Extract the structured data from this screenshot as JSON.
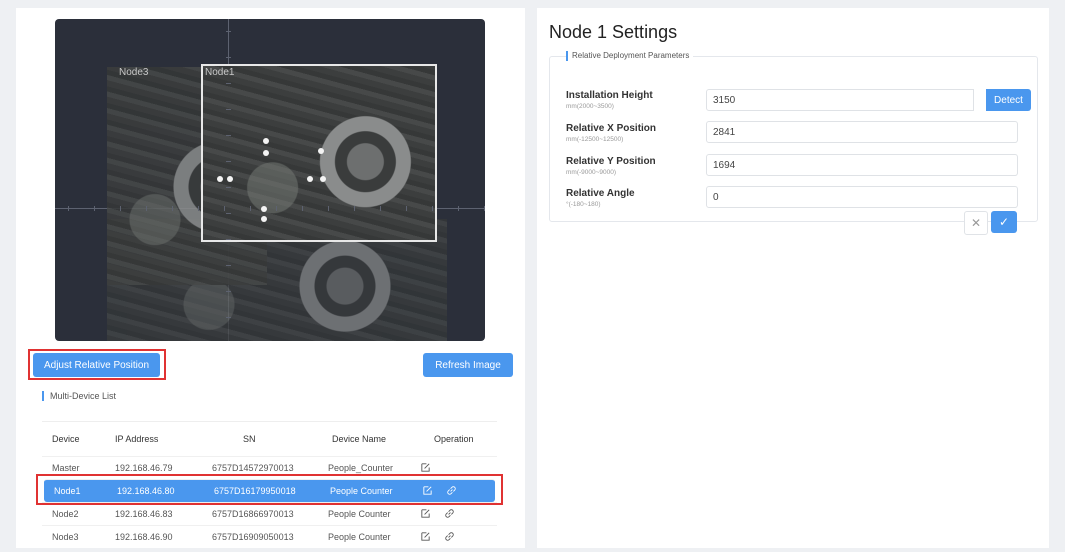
{
  "camera": {
    "node3_label": "Node3",
    "node1_label": "Node1"
  },
  "actions": {
    "adjust_label": "Adjust Relative Position",
    "refresh_label": "Refresh Image"
  },
  "device_list": {
    "title": "Multi-Device List",
    "columns": [
      "Device",
      "IP Address",
      "SN",
      "Device Name",
      "Operation"
    ],
    "rows": [
      {
        "device": "Master",
        "ip": "192.168.46.79",
        "sn": "6757D14572970013",
        "name": "People_Counter",
        "selected": false
      },
      {
        "device": "Node1",
        "ip": "192.168.46.80",
        "sn": "6757D16179950018",
        "name": "People Counter",
        "selected": true
      },
      {
        "device": "Node2",
        "ip": "192.168.46.83",
        "sn": "6757D16866970013",
        "name": "People Counter",
        "selected": false
      },
      {
        "device": "Node3",
        "ip": "192.168.46.90",
        "sn": "6757D16909050013",
        "name": "People Counter",
        "selected": false
      }
    ]
  },
  "settings": {
    "title": "Node 1 Settings",
    "section": "Relative Deployment Parameters",
    "fields": [
      {
        "label": "Installation Height",
        "hint": "mm(2000~3500)",
        "value": "3150"
      },
      {
        "label": "Relative X Position",
        "hint": "mm(-12500~12500)",
        "value": "2841"
      },
      {
        "label": "Relative Y Position",
        "hint": "mm(-9000~9000)",
        "value": "1694"
      },
      {
        "label": "Relative Angle",
        "hint": "°(-180~180)",
        "value": "0"
      }
    ],
    "detect_label": "Detect",
    "cancel_glyph": "✕",
    "confirm_glyph": "✓"
  },
  "colors": {
    "accent": "#4a97ee",
    "highlight_border": "#e03232",
    "camera_bg": "#2b2f3a"
  }
}
